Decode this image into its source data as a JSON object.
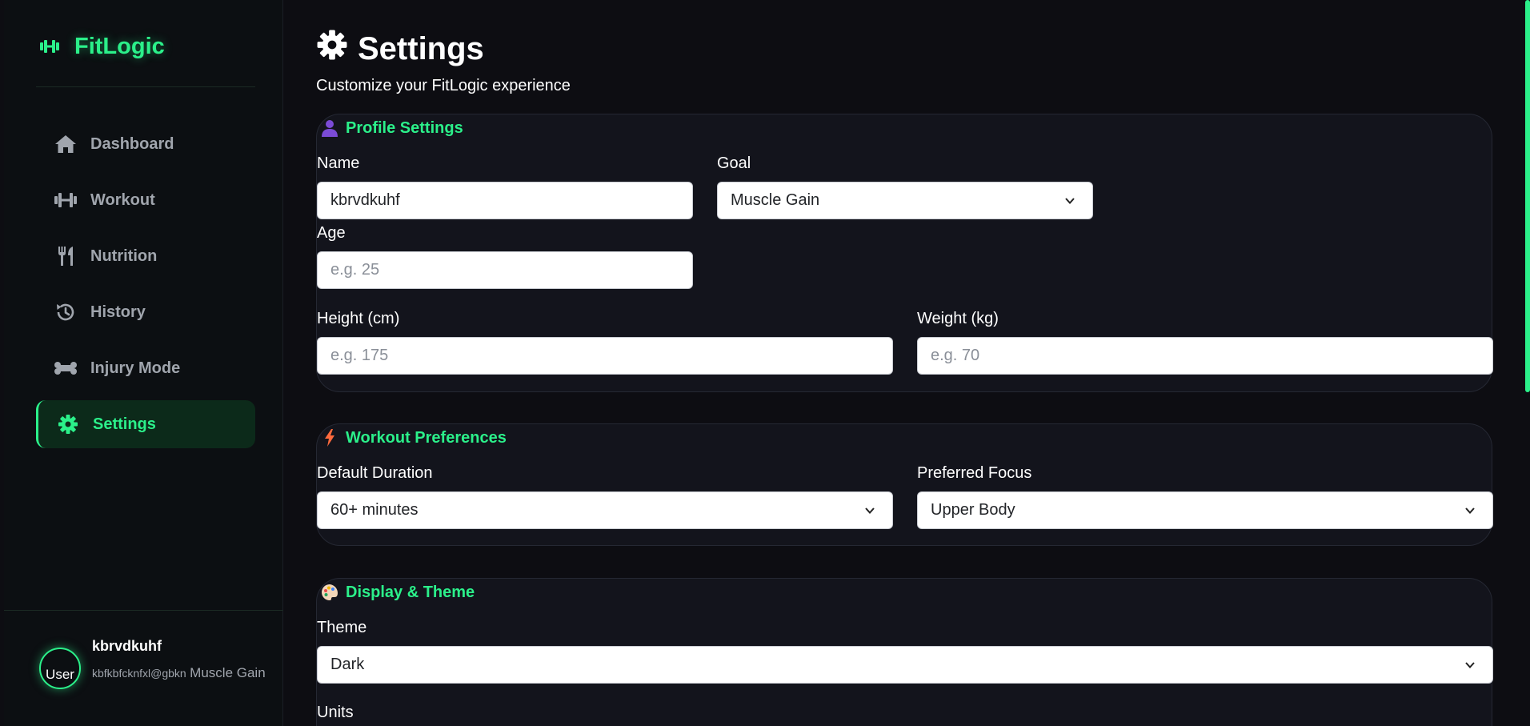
{
  "brand": {
    "name": "FitLogic",
    "accent": "#2bf08a"
  },
  "nav": {
    "items": [
      {
        "label": "Dashboard",
        "icon": "home-icon"
      },
      {
        "label": "Workout",
        "icon": "dumbbell-icon"
      },
      {
        "label": "Nutrition",
        "icon": "utensils-icon"
      },
      {
        "label": "History",
        "icon": "history-icon"
      },
      {
        "label": "Injury Mode",
        "icon": "bone-icon"
      },
      {
        "label": "Settings",
        "icon": "gear-icon",
        "active": true
      }
    ]
  },
  "user": {
    "avatar_alt": "User",
    "name": "kbrvdkuhf",
    "email": "kbfkbfcknfxl@gbkn",
    "goal": "Muscle Gain"
  },
  "header": {
    "title": "Settings",
    "subtitle": "Customize your FitLogic experience"
  },
  "profile": {
    "title": "Profile Settings",
    "name_label": "Name",
    "name_value": "kbrvdkuhf",
    "goal_label": "Goal",
    "goal_value": "Muscle Gain",
    "age_label": "Age",
    "age_placeholder": "e.g. 25",
    "height_label": "Height (cm)",
    "height_placeholder": "e.g. 175",
    "weight_label": "Weight (kg)",
    "weight_placeholder": "e.g. 70"
  },
  "workout_prefs": {
    "title": "Workout Preferences",
    "duration_label": "Default Duration",
    "duration_value": "60+ minutes",
    "focus_label": "Preferred Focus",
    "focus_value": "Upper Body"
  },
  "display": {
    "title": "Display & Theme",
    "theme_label": "Theme",
    "theme_value": "Dark",
    "units_label": "Units"
  }
}
